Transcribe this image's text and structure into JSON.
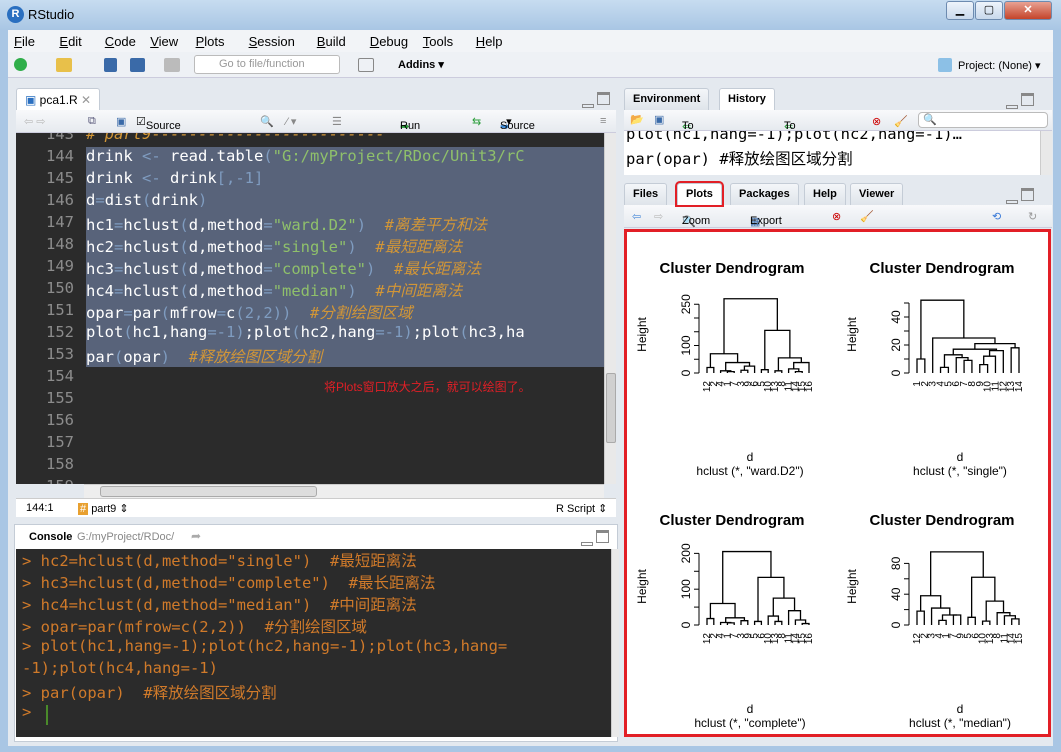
{
  "window": {
    "title": "RStudio",
    "controls": [
      "minimize",
      "maximize",
      "close"
    ]
  },
  "menu": [
    "File",
    "Edit",
    "Code",
    "View",
    "Plots",
    "Session",
    "Build",
    "Debug",
    "Tools",
    "Help"
  ],
  "toolbar": {
    "goto_placeholder": "Go to file/function",
    "addins": "Addins ▾",
    "project": "Project: (None) ▾"
  },
  "editor": {
    "tab": "pca1.R",
    "source_on_save": "Source on Save",
    "source_on_save_checked": true,
    "run": "Run",
    "source": "Source",
    "lines": [
      {
        "n": "143",
        "html": "<span class=\"c\"># part9-------------------------</span>",
        "sel": false
      },
      {
        "n": "144",
        "html": "drink <span class=\"p\">&lt;-</span> read.table<span class=\"p\">(</span><span class=\"s\">\"G:/myProject/RDoc/Unit3/rC</span>",
        "sel": true
      },
      {
        "n": "145",
        "html": "drink <span class=\"p\">&lt;-</span> drink<span class=\"p\">[,-1]</span>",
        "sel": true
      },
      {
        "n": "146",
        "html": "d<span class=\"p\">=</span>dist<span class=\"p\">(</span>drink<span class=\"p\">)</span>",
        "sel": true
      },
      {
        "n": "147",
        "html": "hc1<span class=\"p\">=</span>hclust<span class=\"p\">(</span>d,method<span class=\"p\">=</span><span class=\"s\">\"ward.D2\"</span><span class=\"p\">)</span>  <span class=\"c\">#离差平方和法</span>",
        "sel": true
      },
      {
        "n": "148",
        "html": "hc2<span class=\"p\">=</span>hclust<span class=\"p\">(</span>d,method<span class=\"p\">=</span><span class=\"s\">\"single\"</span><span class=\"p\">)</span>  <span class=\"c\">#最短距离法</span>",
        "sel": true
      },
      {
        "n": "149",
        "html": "hc3<span class=\"p\">=</span>hclust<span class=\"p\">(</span>d,method<span class=\"p\">=</span><span class=\"s\">\"complete\"</span><span class=\"p\">)</span>  <span class=\"c\">#最长距离法</span>",
        "sel": true
      },
      {
        "n": "150",
        "html": "hc4<span class=\"p\">=</span>hclust<span class=\"p\">(</span>d,method<span class=\"p\">=</span><span class=\"s\">\"median\"</span><span class=\"p\">)</span>  <span class=\"c\">#中间距离法</span>",
        "sel": true
      },
      {
        "n": "151",
        "html": "opar<span class=\"p\">=</span>par<span class=\"p\">(</span>mfrow<span class=\"p\">=</span>c<span class=\"p\">(2,2))</span>  <span class=\"c\">#分割绘图区域</span>",
        "sel": true
      },
      {
        "n": "152",
        "html": "plot<span class=\"p\">(</span>hc1,hang<span class=\"p\">=-1)</span>;plot<span class=\"p\">(</span>hc2,hang<span class=\"p\">=-1)</span>;plot<span class=\"p\">(</span>hc3,ha",
        "sel": true
      },
      {
        "n": "153",
        "html": "par<span class=\"p\">(</span>opar<span class=\"p\">)</span>  <span class=\"c\">#释放绘图区域分割</span>",
        "sel": true
      },
      {
        "n": "154",
        "html": "",
        "sel": false
      },
      {
        "n": "155",
        "html": "",
        "sel": false
      },
      {
        "n": "156",
        "html": "",
        "sel": false
      },
      {
        "n": "157",
        "html": "",
        "sel": false
      },
      {
        "n": "158",
        "html": "",
        "sel": false
      },
      {
        "n": "159",
        "html": "",
        "sel": false
      }
    ],
    "annotation": "将Plots窗口放大之后，就可以绘图了。",
    "cursor_pos": "144:1",
    "section": "part9",
    "filetype": "R Script"
  },
  "console": {
    "title": "Console",
    "path": "G:/myProject/RDoc/",
    "lines": [
      "> hc2=hclust(d,method=\"single\")  #最短距离法",
      "> hc3=hclust(d,method=\"complete\")  #最长距离法",
      "> hc4=hclust(d,method=\"median\")  #中间距离法",
      "> opar=par(mfrow=c(2,2))  #分割绘图区域",
      "> plot(hc1,hang=-1);plot(hc2,hang=-1);plot(hc3,hang=",
      "-1);plot(hc4,hang=-1)",
      "> par(opar)  #释放绘图区域分割",
      "> "
    ]
  },
  "history": {
    "tabs": [
      "Environment",
      "History"
    ],
    "active": "History",
    "to_console": "To Console",
    "to_source": "To Source",
    "lines": [
      "plot(hc1,hang=-1);plot(hc2,hang=-1)…",
      "par(opar) #释放绘图区域分割"
    ]
  },
  "files": {
    "tabs": [
      "Files",
      "Plots",
      "Packages",
      "Help",
      "Viewer"
    ],
    "active": "Plots",
    "zoom": "Zoom",
    "export": "Export ▾"
  },
  "highlight_color": "#e21f26",
  "plots": [
    {
      "title": "Cluster Dendrogram",
      "ylabel": "Height",
      "xlabel": "d",
      "sub": "hclust (*, \"ward.D2\")",
      "ymax": 280,
      "ticks": [
        0,
        50,
        100,
        150,
        200,
        250
      ],
      "tick_labels": [
        "0",
        "100",
        "250"
      ],
      "tree": [
        270,
        [
          70,
          [
            20,
            12,
            2
          ],
          [
            38,
            [
              8,
              4,
              [
                5,
                1,
                7
              ]
            ],
            [
              25,
              [
                10,
                3,
                9
              ],
              6
            ]
          ]
        ],
        [
          155,
          [
            12,
            5,
            10
          ],
          [
            55,
            [
              8,
              13,
              8
            ],
            [
              38,
              [
                15,
                11,
                [
                  5,
                  14,
                  15
                ]
              ],
              16
            ]
          ]
        ]
      ]
    },
    {
      "title": "Cluster Dendrogram",
      "ylabel": "Height",
      "xlabel": "d",
      "sub": "hclust (*, \"single\")",
      "ymax": 55,
      "ticks": [
        0,
        10,
        20,
        30,
        40,
        50
      ],
      "tick_labels": [
        "0",
        "20",
        "40"
      ],
      "tree": [
        52,
        [
          10,
          1,
          2
        ],
        [
          25,
          3,
          [
            21,
            [
              17,
              [
                13,
                [
                  4,
                  4,
                  5
                ],
                [
                  11,
                  6,
                  [
                    9,
                    7,
                    8
                  ]
                ]
              ],
              [
                16,
                [
                  12,
                  [
                    6,
                    9,
                    10
                  ],
                  11
                ],
                12
              ]
            ],
            [
              18,
              13,
              14
            ]
          ]
        ]
      ]
    },
    {
      "title": "Cluster Dendrogram",
      "ylabel": "Height",
      "xlabel": "d",
      "sub": "hclust (*, \"complete\")",
      "ymax": 215,
      "ticks": [
        0,
        50,
        100,
        150,
        200
      ],
      "tick_labels": [
        "0",
        "100",
        "200"
      ],
      "tree": [
        205,
        [
          60,
          [
            18,
            12,
            2
          ],
          [
            20,
            [
              7,
              4,
              [
                6,
                1,
                7
              ]
            ],
            [
              12,
              3,
              9
            ]
          ]
        ],
        [
          133,
          [
            10,
            5,
            6
          ],
          [
            75,
            [
              25,
              10,
              [
                10,
                13,
                8
              ]
            ],
            [
              40,
              11,
              [
                14,
                14,
                [
                  4,
                  15,
                  16
                ]
              ]
            ]
          ]
        ]
      ]
    },
    {
      "title": "Cluster Dendrogram",
      "ylabel": "Height",
      "xlabel": "d",
      "sub": "hclust (*, \"median\")",
      "ymax": 100,
      "ticks": [
        0,
        20,
        40,
        60,
        80
      ],
      "tick_labels": [
        "0",
        "40",
        "80"
      ],
      "tree": [
        95,
        [
          38,
          [
            18,
            12,
            2
          ],
          [
            22,
            3,
            [
              13,
              [
                6,
                4,
                1
              ],
              [
                13,
                7,
                9
              ]
            ]
          ]
        ],
        [
          62,
          [
            10,
            5,
            6
          ],
          [
            31,
            [
              5,
              10,
              13
            ],
            [
              16,
              8,
              [
                12,
                11,
                [
                  8,
                  14,
                  15
                ]
              ]
            ]
          ]
        ]
      ]
    }
  ]
}
